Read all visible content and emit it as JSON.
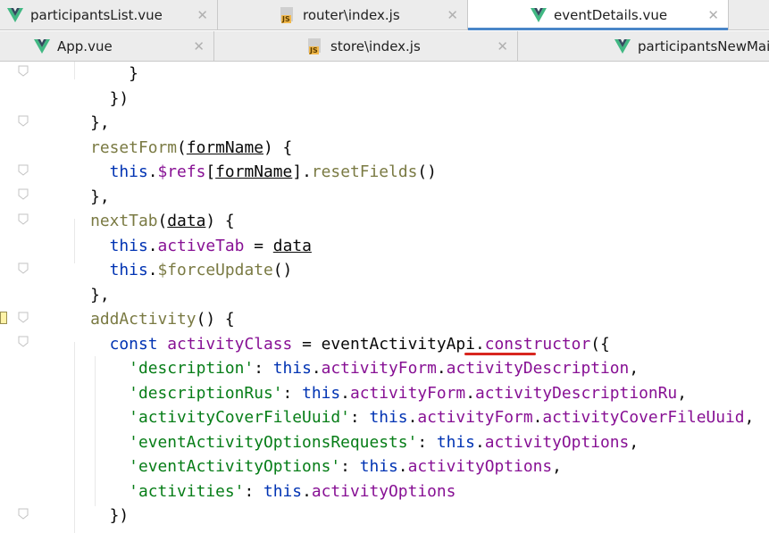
{
  "tabs_row1": [
    {
      "label": "participantsList.vue",
      "icon": "vue-icon",
      "active": false
    },
    {
      "label": "router\\index.js",
      "icon": "js-icon",
      "active": false
    },
    {
      "label": "eventDetails.vue",
      "icon": "vue-icon",
      "active": true
    }
  ],
  "tabs_row2": [
    {
      "label": "App.vue",
      "icon": "vue-icon",
      "active": false
    },
    {
      "label": "store\\index.js",
      "icon": "js-icon",
      "active": false
    },
    {
      "label": "participantsNewMail.vue",
      "icon": "vue-icon",
      "active": false
    }
  ],
  "close_symbol": "✕",
  "js_badge": "JS",
  "colors": {
    "tab_bar": "#ececec",
    "active_tab_indicator": "#4a86c8",
    "vue_green": "#41b883",
    "vue_dark": "#34495e",
    "keyword": "#0033b3",
    "property": "#871094",
    "string": "#067d17",
    "function": "#7a7a43",
    "annotation_underline": "#d8261f"
  },
  "code_lines": [
    [
      {
        "t": "        }",
        "c": ""
      }
    ],
    [
      {
        "t": "      })",
        "c": ""
      }
    ],
    [
      {
        "t": "    },",
        "c": ""
      }
    ],
    [
      {
        "t": "    ",
        "c": ""
      },
      {
        "t": "resetForm",
        "c": "fn"
      },
      {
        "t": "(",
        "c": ""
      },
      {
        "t": "formName",
        "c": "par"
      },
      {
        "t": ") {",
        "c": ""
      }
    ],
    [
      {
        "t": "      ",
        "c": ""
      },
      {
        "t": "this",
        "c": "kw"
      },
      {
        "t": ".",
        "c": ""
      },
      {
        "t": "$refs",
        "c": "prop"
      },
      {
        "t": "[",
        "c": ""
      },
      {
        "t": "formName",
        "c": "par"
      },
      {
        "t": "].",
        "c": ""
      },
      {
        "t": "resetFields",
        "c": "fn"
      },
      {
        "t": "()",
        "c": ""
      }
    ],
    [
      {
        "t": "    },",
        "c": ""
      }
    ],
    [
      {
        "t": "    ",
        "c": ""
      },
      {
        "t": "nextTab",
        "c": "fn"
      },
      {
        "t": "(",
        "c": ""
      },
      {
        "t": "data",
        "c": "par"
      },
      {
        "t": ") {",
        "c": ""
      }
    ],
    [
      {
        "t": "      ",
        "c": ""
      },
      {
        "t": "this",
        "c": "kw"
      },
      {
        "t": ".",
        "c": ""
      },
      {
        "t": "activeTab",
        "c": "prop"
      },
      {
        "t": " = ",
        "c": ""
      },
      {
        "t": "data",
        "c": "par"
      }
    ],
    [
      {
        "t": "      ",
        "c": ""
      },
      {
        "t": "this",
        "c": "kw"
      },
      {
        "t": ".",
        "c": ""
      },
      {
        "t": "$forceUpdate",
        "c": "fn"
      },
      {
        "t": "()",
        "c": ""
      }
    ],
    [
      {
        "t": "    },",
        "c": ""
      }
    ],
    [
      {
        "t": "    ",
        "c": ""
      },
      {
        "t": "addActivity",
        "c": "fn"
      },
      {
        "t": "() {",
        "c": ""
      }
    ],
    [
      {
        "t": "      ",
        "c": ""
      },
      {
        "t": "const",
        "c": "kw"
      },
      {
        "t": " ",
        "c": ""
      },
      {
        "t": "activityClass",
        "c": "prop"
      },
      {
        "t": " = eventActivityApi.",
        "c": ""
      },
      {
        "t": "constructor",
        "c": "prop"
      },
      {
        "t": "({",
        "c": ""
      }
    ],
    [
      {
        "t": "        ",
        "c": ""
      },
      {
        "t": "'description'",
        "c": "str"
      },
      {
        "t": ": ",
        "c": ""
      },
      {
        "t": "this",
        "c": "kw"
      },
      {
        "t": ".",
        "c": ""
      },
      {
        "t": "activityForm",
        "c": "prop"
      },
      {
        "t": ".",
        "c": ""
      },
      {
        "t": "activityDescription",
        "c": "prop"
      },
      {
        "t": ",",
        "c": ""
      }
    ],
    [
      {
        "t": "        ",
        "c": ""
      },
      {
        "t": "'descriptionRus'",
        "c": "str"
      },
      {
        "t": ": ",
        "c": ""
      },
      {
        "t": "this",
        "c": "kw"
      },
      {
        "t": ".",
        "c": ""
      },
      {
        "t": "activityForm",
        "c": "prop"
      },
      {
        "t": ".",
        "c": ""
      },
      {
        "t": "activityDescriptionRu",
        "c": "prop"
      },
      {
        "t": ",",
        "c": ""
      }
    ],
    [
      {
        "t": "        ",
        "c": ""
      },
      {
        "t": "'activityCoverFileUuid'",
        "c": "str"
      },
      {
        "t": ": ",
        "c": ""
      },
      {
        "t": "this",
        "c": "kw"
      },
      {
        "t": ".",
        "c": ""
      },
      {
        "t": "activityForm",
        "c": "prop"
      },
      {
        "t": ".",
        "c": ""
      },
      {
        "t": "activityCoverFileUuid",
        "c": "prop"
      },
      {
        "t": ",",
        "c": ""
      }
    ],
    [
      {
        "t": "        ",
        "c": ""
      },
      {
        "t": "'eventActivityOptionsRequests'",
        "c": "str"
      },
      {
        "t": ": ",
        "c": ""
      },
      {
        "t": "this",
        "c": "kw"
      },
      {
        "t": ".",
        "c": ""
      },
      {
        "t": "activityOptions",
        "c": "prop"
      },
      {
        "t": ",",
        "c": ""
      }
    ],
    [
      {
        "t": "        ",
        "c": ""
      },
      {
        "t": "'eventActivityOptions'",
        "c": "str"
      },
      {
        "t": ": ",
        "c": ""
      },
      {
        "t": "this",
        "c": "kw"
      },
      {
        "t": ".",
        "c": ""
      },
      {
        "t": "activityOptions",
        "c": "prop"
      },
      {
        "t": ",",
        "c": ""
      }
    ],
    [
      {
        "t": "        ",
        "c": ""
      },
      {
        "t": "'activities'",
        "c": "str"
      },
      {
        "t": ": ",
        "c": ""
      },
      {
        "t": "this",
        "c": "kw"
      },
      {
        "t": ".",
        "c": ""
      },
      {
        "t": "activityOptions",
        "c": "prop"
      }
    ],
    [
      {
        "t": "      })",
        "c": ""
      }
    ]
  ]
}
